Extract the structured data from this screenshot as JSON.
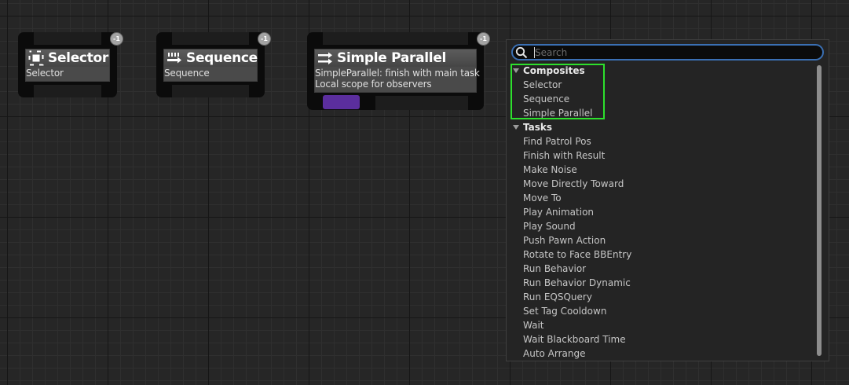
{
  "nodes": [
    {
      "title": "Selector",
      "subtitle": [
        "Selector"
      ],
      "badge": "-1",
      "icon": "selector-icon"
    },
    {
      "title": "Sequence",
      "subtitle": [
        "Sequence"
      ],
      "badge": "-1",
      "icon": "sequence-icon"
    },
    {
      "title": "Simple Parallel",
      "subtitle": [
        "SimpleParallel: finish with main task",
        "Local scope for observers"
      ],
      "badge": "-1",
      "icon": "simple-parallel-icon",
      "pin_color": "#5b2e9e"
    }
  ],
  "menu": {
    "search": {
      "placeholder": "Search",
      "value": ""
    },
    "categories": [
      {
        "label": "Composites",
        "items": [
          "Selector",
          "Sequence",
          "Simple Parallel"
        ]
      },
      {
        "label": "Tasks",
        "items": [
          "Find Patrol Pos",
          "Finish with Result",
          "Make Noise",
          "Move Directly Toward",
          "Move To",
          "Play Animation",
          "Play Sound",
          "Push Pawn Action",
          "Rotate to Face BBEntry",
          "Run Behavior",
          "Run Behavior Dynamic",
          "Run EQSQuery",
          "Set Tag Cooldown",
          "Wait",
          "Wait Blackboard Time"
        ]
      }
    ],
    "footer_item": "Auto Arrange",
    "highlight_color": "#2de02d",
    "accent_color": "#3a6fb3"
  }
}
